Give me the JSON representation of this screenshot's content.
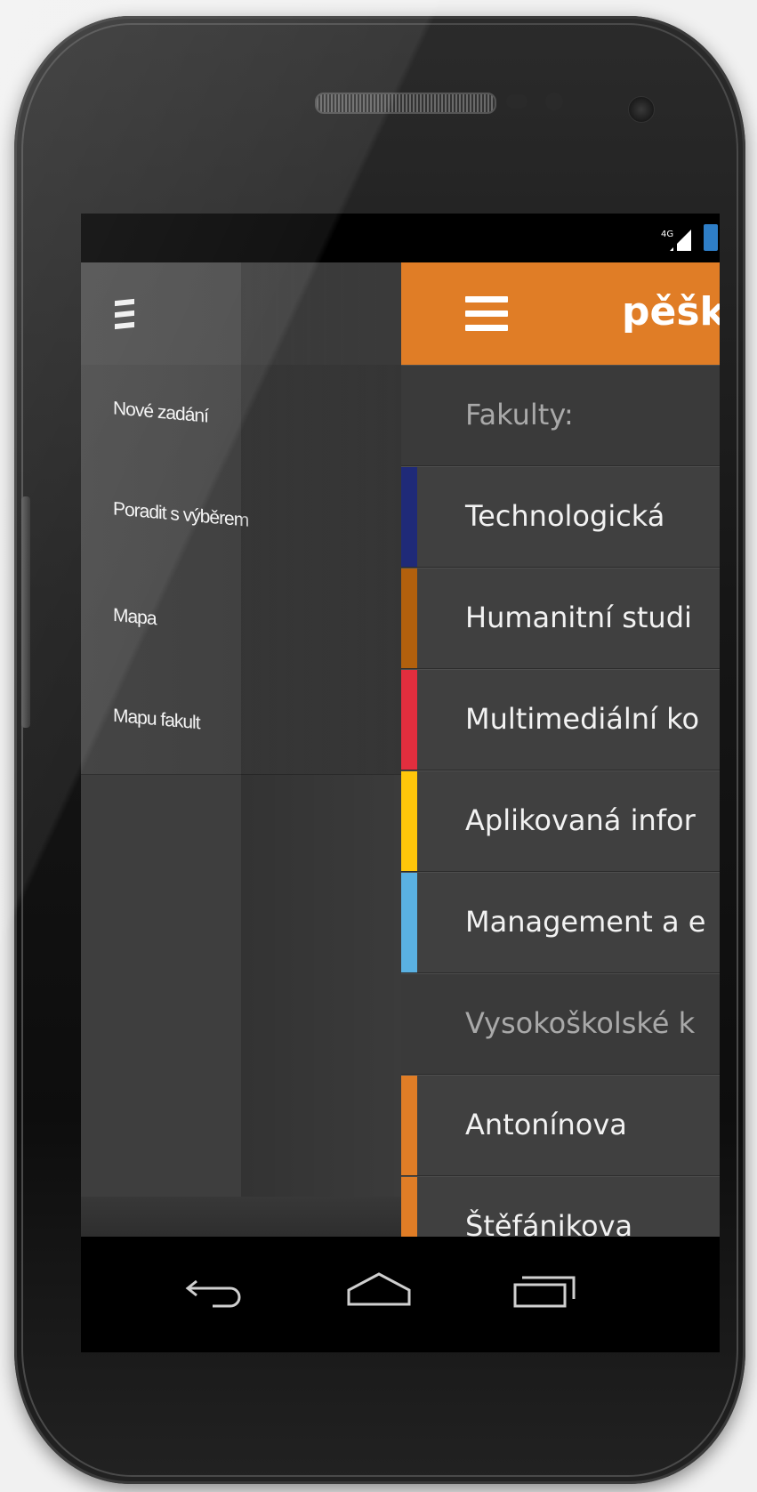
{
  "status_bar": {
    "network": "4G",
    "signal_icon": "signal-bars-icon",
    "battery_icon": "battery-icon"
  },
  "drawer": {
    "menu_icon": "hamburger-icon",
    "items": [
      {
        "label": "Nové zadání"
      },
      {
        "label": "Poradit s výběrem"
      },
      {
        "label": "Mapa"
      },
      {
        "label": "Mapu fakult"
      }
    ]
  },
  "app_bar": {
    "menu_icon": "hamburger-icon",
    "title": "pěšk",
    "color": "#e07d26"
  },
  "list": {
    "sections": [
      {
        "header": "Fakulty:",
        "items": [
          {
            "label": "Technologická",
            "color": "#1f2a78"
          },
          {
            "label": "Humanitní studi",
            "color": "#b2600d"
          },
          {
            "label": "Multimediální ko",
            "color": "#e22e3e"
          },
          {
            "label": "Aplikovaná infor",
            "color": "#ffc60a"
          },
          {
            "label": "Management a e",
            "color": "#5ab1e2"
          }
        ]
      },
      {
        "header": "Vysokoškolské k",
        "items": [
          {
            "label": "Antonínova",
            "color": "#e07d26"
          },
          {
            "label": "Štěfánikova",
            "color": "#e07d26"
          }
        ]
      }
    ]
  },
  "nav_bar": {
    "back_icon": "back-icon",
    "home_icon": "home-icon",
    "recents_icon": "recent-apps-icon"
  }
}
